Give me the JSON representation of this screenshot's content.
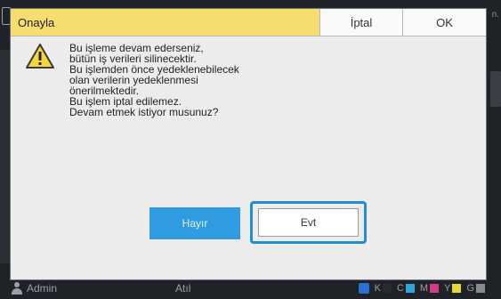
{
  "background": {
    "right_text": "n.",
    "status_bar": {
      "user": "Admin",
      "status": "Atıl",
      "ink_letters": [
        "K",
        "C",
        "M",
        "Y",
        "G"
      ],
      "ink_colors": {
        "K": "#2a2a2a",
        "C": "#31a3dd",
        "M": "#d43a8c",
        "Y": "#e5d63a",
        "G": "#8a8a8a"
      }
    }
  },
  "dialog": {
    "title": "Onayla",
    "cancel_label": "İptal",
    "ok_label": "OK",
    "title_color": "#f7dc6f",
    "message_lines": [
      "Bu işleme devam ederseniz,",
      "bütün iş verileri silinecektir.",
      "Bu işlemden önce yedeklenebilecek",
      "olan verilerin yedeklenmesi",
      "önerilmektedir.",
      "Bu işlem iptal edilemez.",
      "Devam etmek istiyor musunuz?"
    ],
    "no_label": "Hayır",
    "yes_label": "Evt",
    "accent_color": "#2f9be0"
  },
  "icons": {
    "warning": "warning-icon",
    "user": "person-icon",
    "ink": "ink-drop-icon"
  }
}
